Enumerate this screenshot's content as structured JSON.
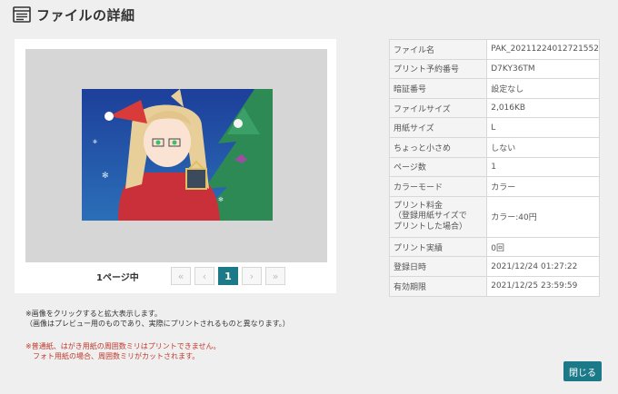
{
  "header": {
    "title": "ファイルの詳細",
    "icon": "document-list-icon"
  },
  "preview": {
    "page_label": "1ページ中",
    "current_page": "1",
    "pager": {
      "first": "«",
      "prev": "‹",
      "next": "›",
      "last": "»"
    }
  },
  "details": {
    "rows": [
      {
        "label": "ファイル名",
        "value": "PAK_20211224012721552"
      },
      {
        "label": "プリント予約番号",
        "value": "D7KY36TM"
      },
      {
        "label": "暗証番号",
        "value": "設定なし"
      },
      {
        "label": "ファイルサイズ",
        "value": "2,016KB"
      },
      {
        "label": "用紙サイズ",
        "value": "L"
      },
      {
        "label": "ちょっと小さめ",
        "value": "しない"
      },
      {
        "label": "ページ数",
        "value": "1"
      },
      {
        "label": "カラーモード",
        "value": "カラー"
      },
      {
        "label_lines": [
          "プリント料金",
          "（登録用紙サイズで",
          "プリントした場合）"
        ],
        "value": "カラー:40円"
      },
      {
        "label": "プリント実績",
        "value": "0回"
      },
      {
        "label": "登録日時",
        "value": "2021/12/24 01:27:22"
      },
      {
        "label": "有効期限",
        "value": "2021/12/25 23:59:59"
      }
    ]
  },
  "notes": [
    "※画像をクリックすると拡大表示します。",
    "（画像はプレビュー用のものであり、実際にプリントされるものと異なります。）"
  ],
  "warnings": [
    "※普通紙、はがき用紙の周囲数ミリはプリントできません。",
    "　フォト用紙の場合、周囲数ミリがカットされます。"
  ],
  "actions": {
    "close_label": "閉じる"
  },
  "colors": {
    "accent": "#1c7a88",
    "warning": "#c0392b"
  }
}
